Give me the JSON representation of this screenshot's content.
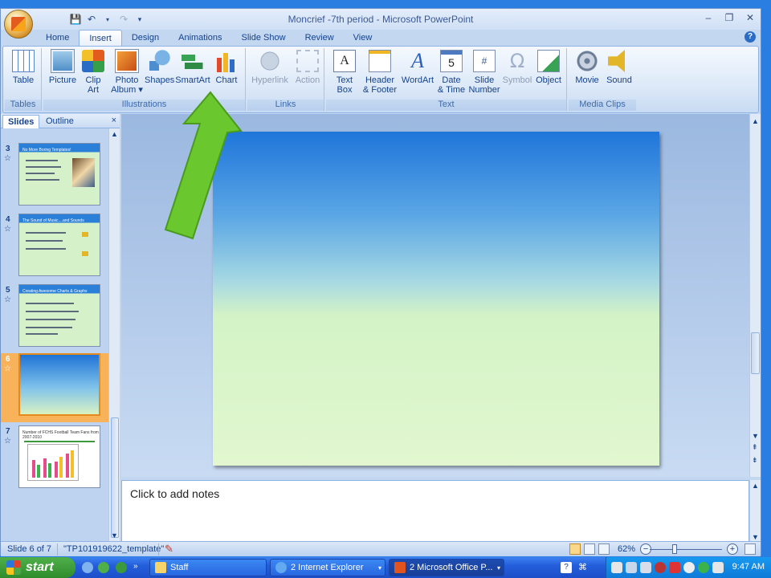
{
  "window": {
    "title": "Moncrief -7th period - Microsoft PowerPoint",
    "controls": [
      "–",
      "❐",
      "✕"
    ]
  },
  "tabs": [
    "Home",
    "Insert",
    "Design",
    "Animations",
    "Slide Show",
    "Review",
    "View"
  ],
  "active_tab": "Insert",
  "ribbon": {
    "groups": {
      "tables": "Tables",
      "illustrations": "Illustrations",
      "links": "Links",
      "text": "Text",
      "media": "Media Clips"
    },
    "buttons": {
      "table": "Table",
      "picture": "Picture",
      "clipart": "Clip\nArt",
      "photo_album": "Photo\nAlbum ▾",
      "shapes": "Shapes",
      "smartart": "SmartArt",
      "chart": "Chart",
      "hyperlink": "Hyperlink",
      "action": "Action",
      "text_box": "Text\nBox",
      "header_footer": "Header\n& Footer",
      "wordart": "WordArt",
      "date_time": "Date\n& Time",
      "slide_number": "Slide\nNumber",
      "symbol": "Symbol",
      "object": "Object",
      "movie": "Movie",
      "sound": "Sound"
    },
    "icon_glyphs": {
      "textbox": "A",
      "wordart": "A",
      "date": "5",
      "slidenum": "#",
      "symbol": "Ω"
    }
  },
  "left_pane": {
    "tabs": [
      "Slides",
      "Outline"
    ],
    "close": "×",
    "slides": [
      {
        "num": "3",
        "title": "No More Boring Templates!"
      },
      {
        "num": "4",
        "title": "The Sound of Music....and Sounds"
      },
      {
        "num": "5",
        "title": "Creating Awesome Charts & Graphs"
      },
      {
        "num": "6",
        "title": ""
      },
      {
        "num": "7",
        "title": "Number of FCHS Football Team Fans from 2007-2010"
      }
    ],
    "selected_slide": "6"
  },
  "notes": {
    "placeholder": "Click to add notes"
  },
  "status": {
    "slide_indicator": "Slide 6 of 7",
    "theme": "\"TP101919622_template\"",
    "zoom": "62%"
  },
  "taskbar": {
    "start_label": "start",
    "tasks": [
      "Staff",
      "2 Internet Explorer",
      "2 Microsoft Office P..."
    ],
    "clock": "9:47 AM"
  }
}
